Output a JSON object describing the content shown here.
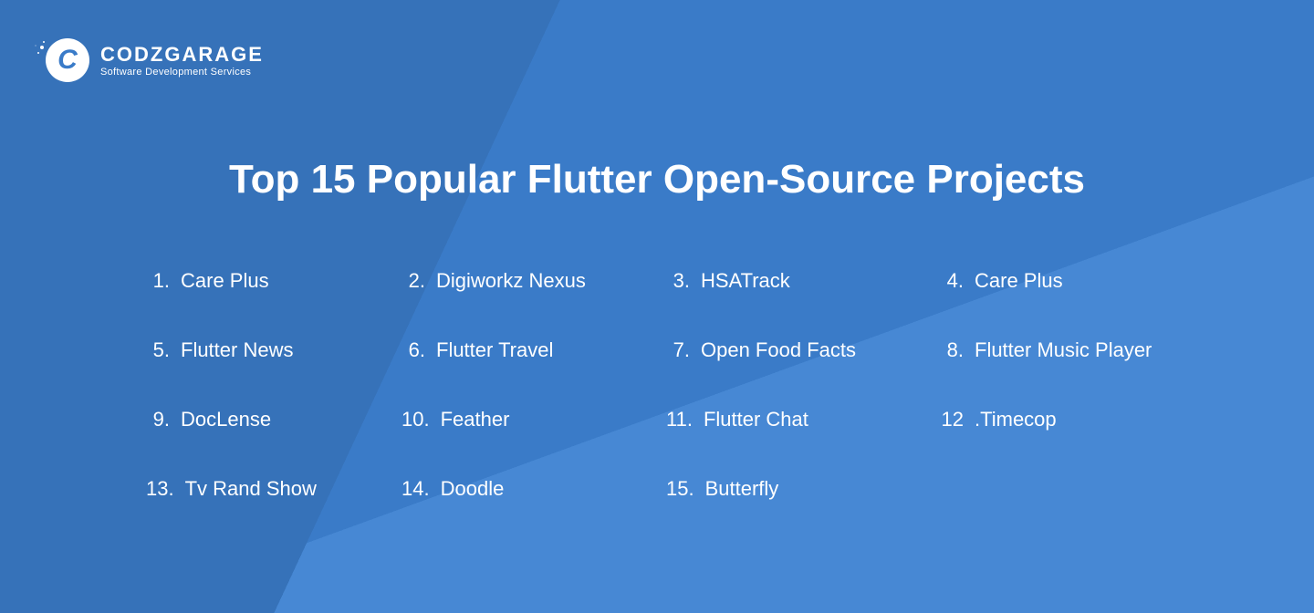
{
  "brand": {
    "letter": "C",
    "name": "CODZGARAGE",
    "tagline": "Software Development Services"
  },
  "title": "Top 15 Popular Flutter Open-Source Projects",
  "projects": [
    {
      "num": "1.",
      "name": "Care Plus"
    },
    {
      "num": "2.",
      "name": "Digiworkz Nexus"
    },
    {
      "num": "3.",
      "name": "HSATrack"
    },
    {
      "num": "4.",
      "name": "Care Plus"
    },
    {
      "num": "5.",
      "name": "Flutter News"
    },
    {
      "num": "6.",
      "name": "Flutter Travel"
    },
    {
      "num": "7.",
      "name": "Open Food Facts"
    },
    {
      "num": "8.",
      "name": "Flutter Music Player"
    },
    {
      "num": "9.",
      "name": "DocLense"
    },
    {
      "num": "10.",
      "name": "Feather"
    },
    {
      "num": "11.",
      "name": "Flutter Chat"
    },
    {
      "num": "12",
      "name": ".Timecop"
    },
    {
      "num": "13.",
      "name": "Tv Rand Show"
    },
    {
      "num": "14.",
      "name": "Doodle"
    },
    {
      "num": "15.",
      "name": "Butterfly"
    }
  ]
}
